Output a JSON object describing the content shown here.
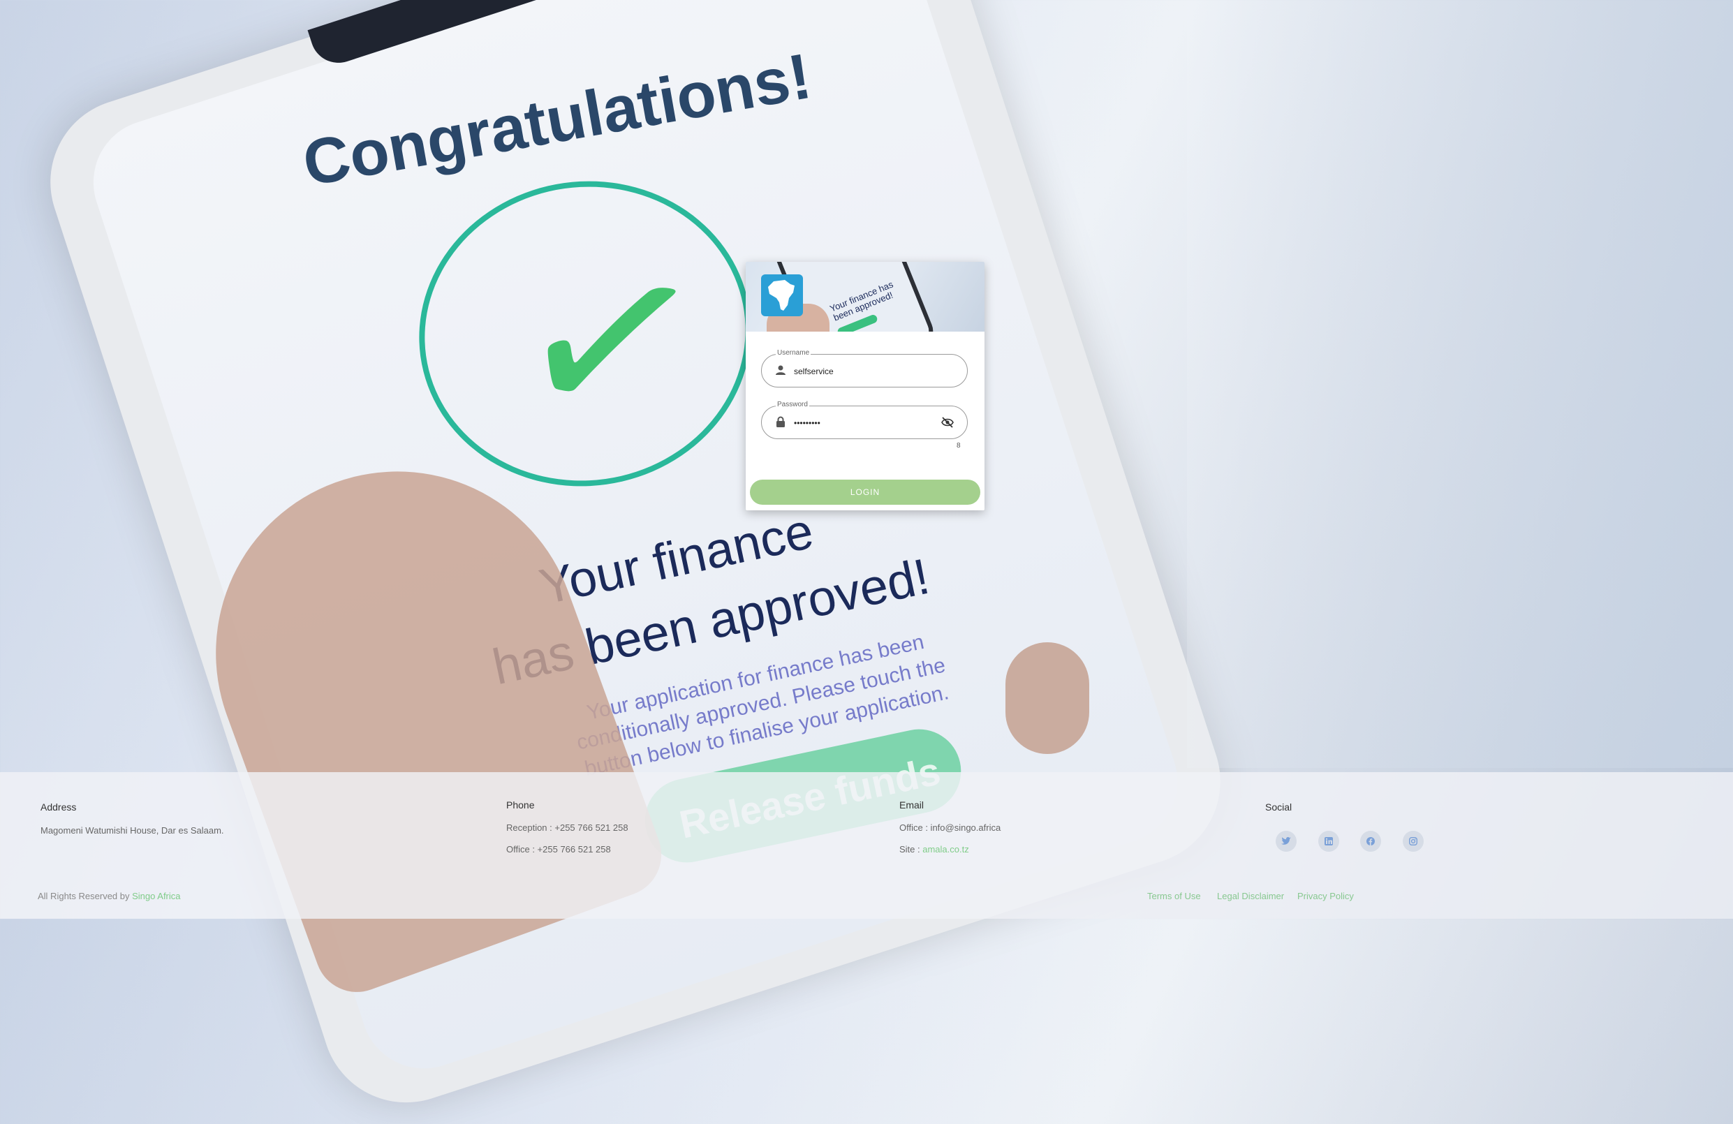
{
  "background": {
    "headline": "Congratulations!",
    "finance_line1": "Your finance",
    "finance_line2": "has been approved!",
    "small_text": "Your application for finance has been conditionally approved. Please touch the button below to finalise your application.",
    "release_button": "Release funds"
  },
  "login": {
    "banner": {
      "phone_text": "Your finance has been approved!"
    },
    "username": {
      "label": "Username",
      "value": "selfservice",
      "icon": "person-icon"
    },
    "password": {
      "label": "Password",
      "value": "•••••••••",
      "icon": "lock-icon",
      "toggle_icon": "eye-off-icon",
      "char_count": "8"
    },
    "login_button": "LOGIN",
    "button_color": "#a4d08d"
  },
  "footer": {
    "address": {
      "title": "Address",
      "line": "Magomeni Watumishi House, Dar es Salaam."
    },
    "phone": {
      "title": "Phone",
      "reception": "Reception : +255 766 521 258",
      "office": "Office : +255 766 521 258"
    },
    "email": {
      "title": "Email",
      "office": "Office : info@singo.africa",
      "site_label": "Site : ",
      "site_link": "amala.co.tz"
    },
    "social": {
      "title": "Social",
      "icons": [
        "twitter-icon",
        "linkedin-icon",
        "facebook-icon",
        "instagram-icon"
      ]
    },
    "rights_prefix": "All Rights Reserved by ",
    "rights_link": "Singo Africa",
    "links": [
      "Terms of Use",
      "Legal Disclaimer",
      "Privacy Policy"
    ]
  }
}
